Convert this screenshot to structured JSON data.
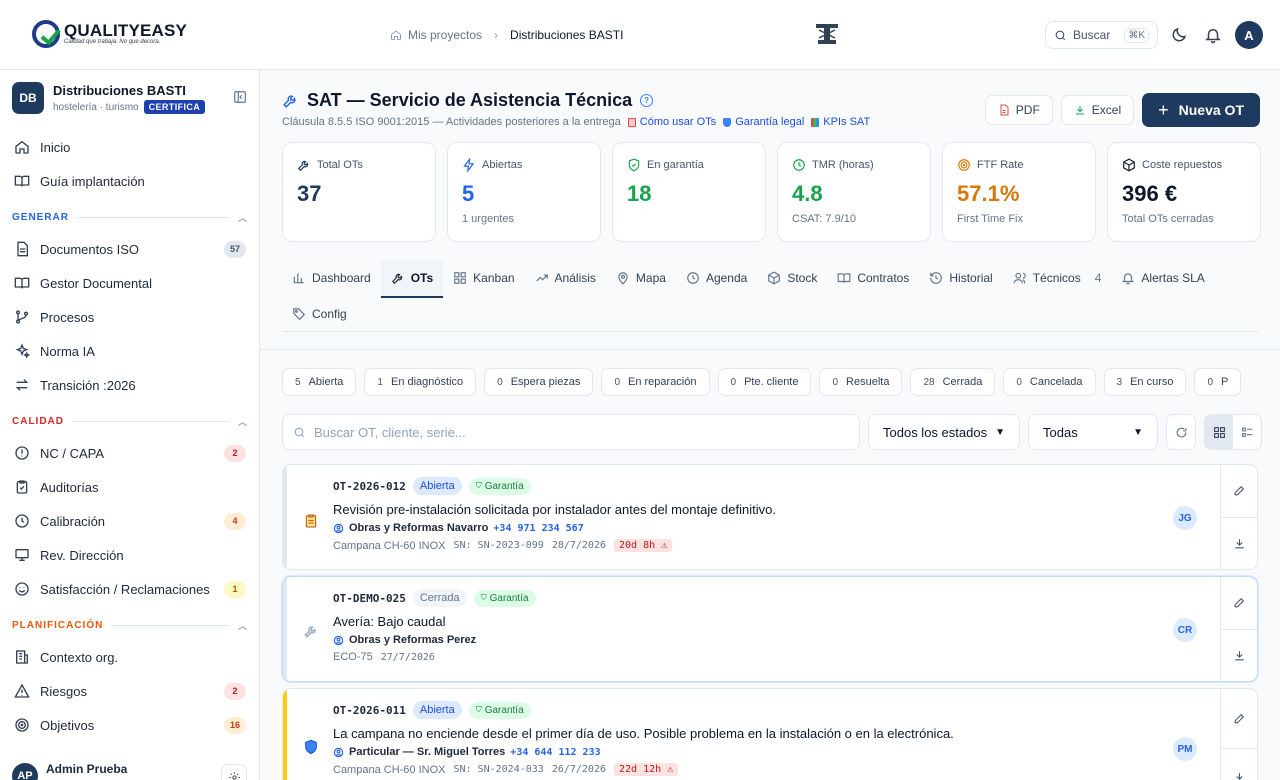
{
  "brand": {
    "name": "QUALITYEASY",
    "tagline": "Calidad que trabaja. No que decora."
  },
  "breadcrumb": {
    "home": "Mis proyectos",
    "current": "Distribuciones BASTI"
  },
  "topbar": {
    "search_label": "Buscar",
    "search_shortcut": "⌘K",
    "avatar": "A"
  },
  "org": {
    "initials": "DB",
    "name": "Distribuciones BASTI",
    "sector": "hostelería · turismo",
    "badge": "CERTIFICA"
  },
  "nav": {
    "top": [
      {
        "label": "Inicio"
      },
      {
        "label": "Guía implantación"
      }
    ],
    "generar": {
      "title": "GENERAR",
      "items": [
        {
          "label": "Documentos ISO",
          "count": "57"
        },
        {
          "label": "Gestor Documental"
        },
        {
          "label": "Procesos"
        },
        {
          "label": "Norma IA"
        },
        {
          "label": "Transición :2026"
        }
      ]
    },
    "calidad": {
      "title": "CALIDAD",
      "items": [
        {
          "label": "NC / CAPA",
          "count": "2"
        },
        {
          "label": "Auditorías"
        },
        {
          "label": "Calibración",
          "count": "4"
        },
        {
          "label": "Rev. Dirección"
        },
        {
          "label": "Satisfacción / Reclamaciones",
          "count": "1"
        }
      ]
    },
    "planificacion": {
      "title": "PLANIFICACIÓN",
      "items": [
        {
          "label": "Contexto org."
        },
        {
          "label": "Riesgos",
          "count": "2"
        },
        {
          "label": "Objetivos",
          "count": "16"
        }
      ]
    }
  },
  "user": {
    "initials": "AP",
    "name": "Admin Prueba"
  },
  "page": {
    "title": "SAT — Servicio de Asistencia Técnica",
    "subtitle": "Cláusula 8.5.5 ISO 9001:2015 — Actividades posteriores a la entrega",
    "links": [
      "Cómo usar OTs",
      "Garantía legal",
      "KPIs SAT"
    ],
    "btn_pdf": "PDF",
    "btn_excel": "Excel",
    "btn_new": "Nueva OT"
  },
  "kpis": [
    {
      "label": "Total OTs",
      "value": "37",
      "sub": "",
      "color": "#1e3a5f",
      "icon": "wrench-icon"
    },
    {
      "label": "Abiertas",
      "value": "5",
      "sub": "1 urgentes",
      "color": "#2563eb",
      "icon": "bolt-icon"
    },
    {
      "label": "En garantía",
      "value": "18",
      "sub": "",
      "color": "#16a34a",
      "icon": "shield-check-icon"
    },
    {
      "label": "TMR (horas)",
      "value": "4.8",
      "sub": "CSAT: 7.9/10",
      "color": "#16a34a",
      "icon": "clock-icon"
    },
    {
      "label": "FTF Rate",
      "value": "57.1%",
      "sub": "First Time Fix",
      "color": "#d97706",
      "icon": "target-icon"
    },
    {
      "label": "Coste repuestos",
      "value": "396 €",
      "sub": "Total OTs cerradas",
      "color": "#0f172a",
      "icon": "box-icon"
    }
  ],
  "tabs": [
    "Dashboard",
    "OTs",
    "Kanban",
    "Análisis",
    "Mapa",
    "Agenda",
    "Stock",
    "Contratos",
    "Historial",
    "Técnicos",
    "Alertas SLA",
    "Config"
  ],
  "tech_count": "4",
  "status_chips": [
    {
      "n": "5",
      "label": "Abierta"
    },
    {
      "n": "1",
      "label": "En diagnóstico"
    },
    {
      "n": "0",
      "label": "Espera piezas"
    },
    {
      "n": "0",
      "label": "En reparación"
    },
    {
      "n": "0",
      "label": "Pte. cliente"
    },
    {
      "n": "0",
      "label": "Resuelta"
    },
    {
      "n": "28",
      "label": "Cerrada"
    },
    {
      "n": "0",
      "label": "Cancelada"
    },
    {
      "n": "3",
      "label": "En curso"
    },
    {
      "n": "0",
      "label": "P"
    }
  ],
  "filters": {
    "search_placeholder": "Buscar OT, cliente, serie...",
    "status": "Todos los estados",
    "priority": "Todas"
  },
  "orders": [
    {
      "code": "OT-2026-012",
      "status": "Abierta",
      "warranty": "Garantía",
      "desc": "Revisión pre-instalación solicitada por instalador antes del montaje definitivo.",
      "client": "Obras y Reformas Navarro",
      "phone": "+34 971 234 567",
      "equipment": "Campana CH-60 INOX",
      "serial": "SN: SN-2023-099",
      "date": "28/7/2026",
      "sla": "20d 8h ⚠",
      "tech": "JG",
      "accent": "#e2e8f0"
    },
    {
      "code": "OT-DEMO-025",
      "status": "Cerrada",
      "warranty": "Garantía",
      "desc": "Avería: Bajo caudal",
      "client": "Obras y Reformas Perez",
      "phone": "",
      "equipment": "ECO-75",
      "serial": "",
      "date": "27/7/2026",
      "sla": "",
      "tech": "CR",
      "accent": "#e2e8f0"
    },
    {
      "code": "OT-2026-011",
      "status": "Abierta",
      "warranty": "Garantía",
      "desc": "La campana no enciende desde el primer día de uso. Posible problema en la instalación o en la electrónica.",
      "client": "Particular — Sr. Miguel Torres",
      "phone": "+34 644 112 233",
      "equipment": "Campana CH-60 INOX",
      "serial": "SN: SN-2024-033",
      "date": "26/7/2026",
      "sla": "22d 12h ⚠",
      "tech": "PM",
      "accent": "#facc15"
    }
  ]
}
